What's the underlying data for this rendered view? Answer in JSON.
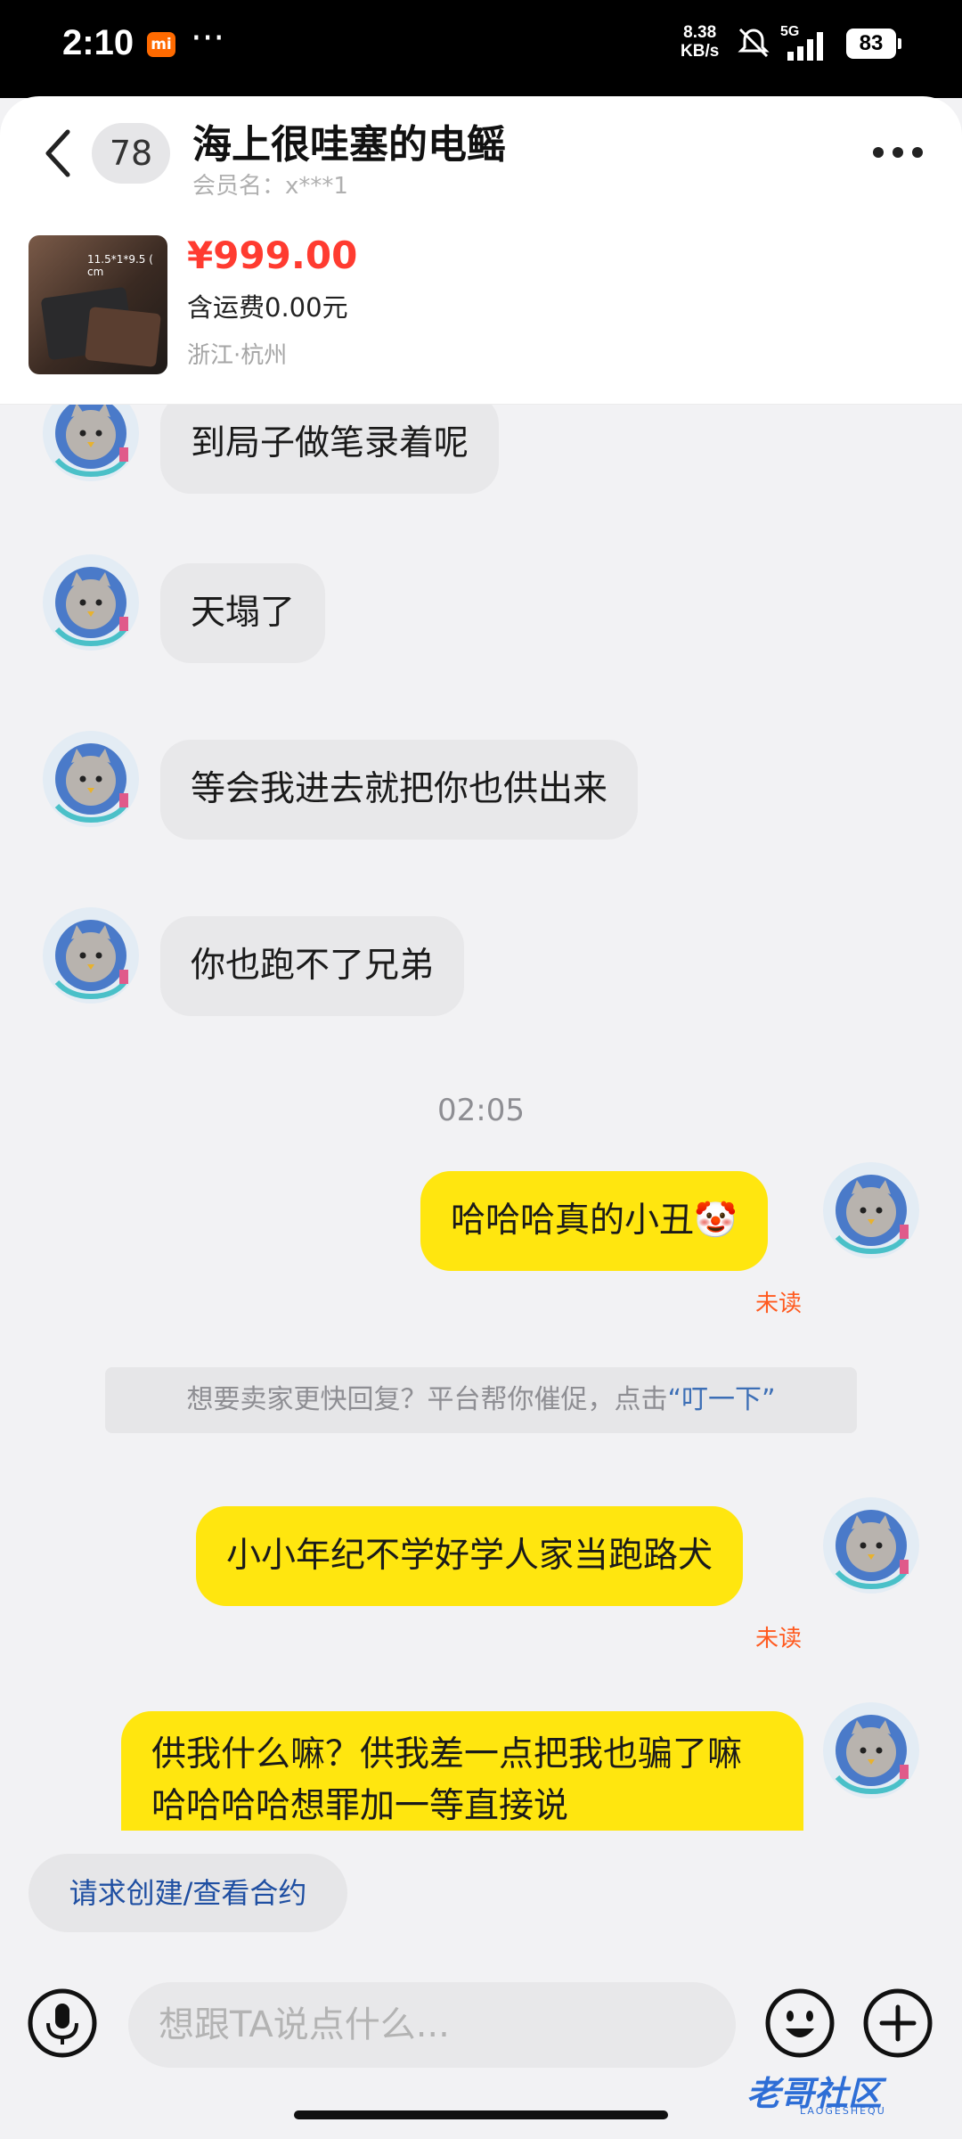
{
  "status_bar": {
    "time": "2:10",
    "mi_badge": "mi",
    "menu_dots": "···",
    "net_speed": "8.38",
    "net_unit": "KB/s",
    "network": "5G",
    "battery": "83"
  },
  "header": {
    "unread_count": "78",
    "title": "海上很哇塞的电鳐",
    "member": "会员名：x***1"
  },
  "product": {
    "dimensions": "11.5*1*9.5 ( cm",
    "price": "¥999.00",
    "shipping": "含运费0.00元",
    "location": "浙江·杭州"
  },
  "messages": {
    "incoming": [
      "到局子做笔录着呢",
      "天塌了",
      "等会我进去就把你也供出来",
      "你也跑不了兄弟"
    ],
    "time_divider": "02:05",
    "outgoing_1": "哈哈哈真的小丑🤡",
    "unread_label_1": "未读",
    "notice_text": "想要卖家更快回复？平台帮你催促，点击",
    "notice_link": "“叮一下”",
    "outgoing_2": "小小年纪不学好学人家当跑路犬",
    "unread_label_2": "未读",
    "outgoing_3": "供我什么嘛？供我差一点把我也骗了嘛哈哈哈哈想罪加一等直接说"
  },
  "bottom": {
    "contract_button": "请求创建/查看合约",
    "input_placeholder": "想跟TA说点什么..."
  },
  "watermark": {
    "text": "老哥社区",
    "sub": "LAOGESHEQU"
  },
  "colors": {
    "accent_yellow": "#ffe60f",
    "price_red": "#ff3b30",
    "unread_orange": "#ff5a1f",
    "link_blue": "#3d6fb6"
  }
}
